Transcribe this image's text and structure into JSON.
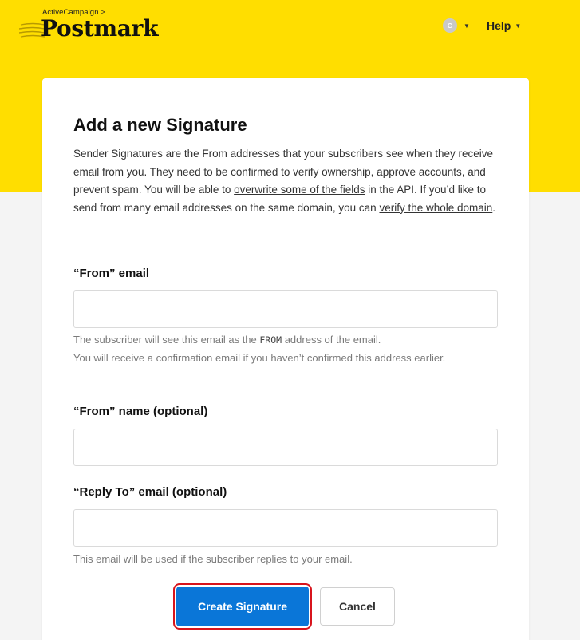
{
  "header": {
    "brand_prefix": "ActiveCampaign >",
    "brand_name": "Postmark",
    "user_initial": "G",
    "help_label": "Help",
    "background_color": "#ffde00"
  },
  "form": {
    "title": "Add a new Signature",
    "intro": {
      "text_1": "Sender Signatures are the From addresses that your subscribers see when they receive email from you. They need to be confirmed to verify ownership, approve accounts, and prevent spam. You will be able to ",
      "link_1": "overwrite some of the fields",
      "text_2": " in the API. If you’d like to send from many email addresses on the same domain, you can ",
      "link_2": "verify the whole domain",
      "text_3": "."
    },
    "from_email": {
      "label": "“From” email",
      "value": "",
      "hint_1_pre": "The subscriber will see this email as the ",
      "hint_1_code": "FROM",
      "hint_1_post": " address of the email.",
      "hint_2": "You will receive a confirmation email if you haven’t confirmed this address earlier."
    },
    "from_name": {
      "label": "“From” name (optional)",
      "value": ""
    },
    "reply_to": {
      "label": "“Reply To” email (optional)",
      "value": "",
      "hint": "This email will be used if the subscriber replies to your email."
    },
    "create_button": "Create Signature",
    "cancel_button": "Cancel",
    "primary_color": "#0a76d8"
  }
}
